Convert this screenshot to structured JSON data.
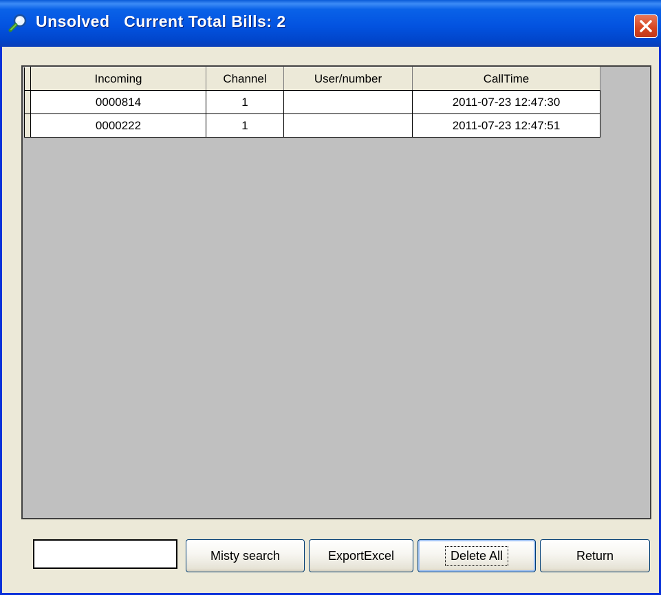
{
  "window": {
    "title": "Unsolved   Current Total Bills: 2",
    "title_icon": "magnifier-icon",
    "close_icon": "close-icon",
    "accent_color": "#0353e0",
    "close_color": "#d6441e"
  },
  "grid": {
    "columns": [
      "Incoming",
      "Channel",
      "User/number",
      "CallTime"
    ],
    "rows": [
      [
        "0000814",
        "1",
        "",
        "2011-07-23 12:47:30"
      ],
      [
        "0000222",
        "1",
        "",
        "2011-07-23 12:47:51"
      ]
    ]
  },
  "toolbar": {
    "search_value": "",
    "misty_search_label": "Misty search",
    "export_excel_label": "ExportExcel",
    "delete_all_label": "Delete All",
    "return_label": "Return"
  }
}
